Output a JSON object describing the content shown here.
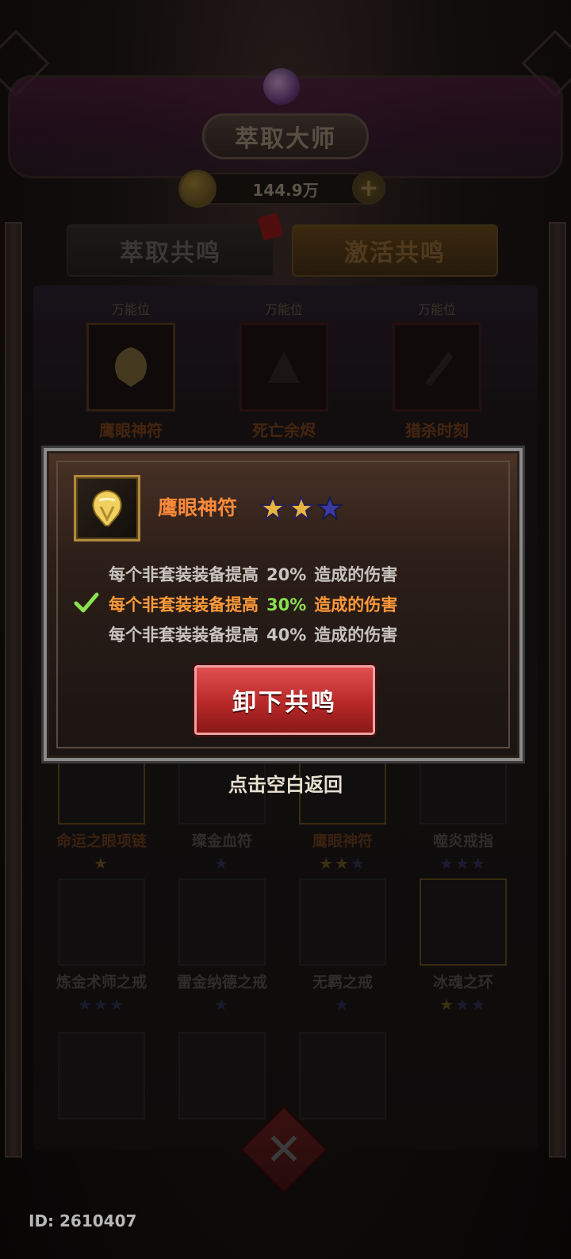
{
  "header": {
    "title": "萃取大师",
    "currency_amount": "144.9万"
  },
  "tabs": [
    {
      "label": "萃取共鸣",
      "active": false
    },
    {
      "label": "激活共鸣",
      "active": true
    }
  ],
  "slots": [
    {
      "tag": "万能位",
      "name": "鹰眼神符",
      "icon": "feather-talisman-icon"
    },
    {
      "tag": "万能位",
      "name": "死亡余烬",
      "icon": "ember-icon"
    },
    {
      "tag": "万能位",
      "name": "猎杀时刻",
      "icon": "arrows-icon"
    }
  ],
  "grid": {
    "row1": [
      {
        "name": "命运之眼项链",
        "stars_on": 1,
        "stars_total": 1
      },
      {
        "name": "璨金血符",
        "stars_on": 0,
        "stars_total": 1
      },
      {
        "name": "鹰眼神符",
        "stars_on": 2,
        "stars_total": 3
      },
      {
        "name": "噬炎戒指",
        "stars_on": 0,
        "stars_total": 3
      }
    ],
    "row2": [
      {
        "name": "炼金术师之戒",
        "stars_on": 0,
        "stars_total": 3
      },
      {
        "name": "雷金纳德之戒",
        "stars_on": 0,
        "stars_total": 1
      },
      {
        "name": "无羁之戒",
        "stars_on": 0,
        "stars_total": 1
      },
      {
        "name": "冰魂之环",
        "stars_on": 1,
        "stars_total": 3
      }
    ]
  },
  "modal": {
    "item_name": "鹰眼神符",
    "stars_on": 2,
    "stars_total": 3,
    "effects": [
      {
        "prefix": "每个非套装装备提高",
        "value": "20%",
        "suffix": "造成的伤害",
        "active": false
      },
      {
        "prefix": "每个非套装装备提高",
        "value": "30%",
        "suffix": "造成的伤害",
        "active": true
      },
      {
        "prefix": "每个非套装装备提高",
        "value": "40%",
        "suffix": "造成的伤害",
        "active": false
      }
    ],
    "button_label": "卸下共鸣"
  },
  "hint": "点击空白返回",
  "footer": {
    "user_id": "ID: 2610407"
  },
  "colors": {
    "accent_orange": "#ff8a3a",
    "active_value_green": "#8ae050",
    "button_red": "#c83030",
    "star_gold": "#e0b040",
    "star_empty": "#3a3a9a"
  }
}
